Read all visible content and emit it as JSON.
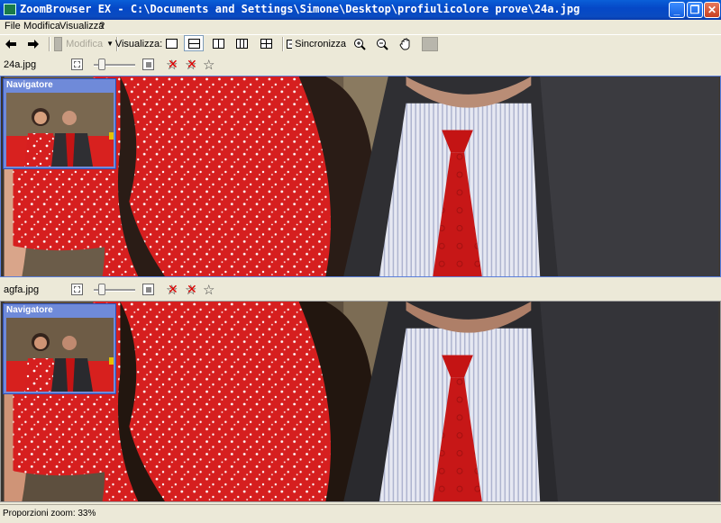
{
  "window": {
    "title": "ZoomBrowser EX - C:\\Documents and Settings\\Simone\\Desktop\\profiulicolore prove\\24a.jpg"
  },
  "menu": [
    "File",
    "Modifica",
    "Visualizza",
    "?"
  ],
  "toolbar": {
    "modifica_label": "Modifica",
    "visualizza_label": "Visualizza:",
    "sincronizza_label": "Sincronizza",
    "active_view": "split-horizontal"
  },
  "panels": [
    {
      "filename": "24a.jpg",
      "navigator_title": "Navigatore",
      "zoom_slider_value": 0.2
    },
    {
      "filename": "agfa.jpg",
      "navigator_title": "Navigatore",
      "zoom_slider_value": 0.2
    }
  ],
  "status": {
    "zoom_text": "Proporzioni zoom: 33%"
  },
  "colors": {
    "titlebar": "#0a4bc0",
    "navigator": "#6f8ad9",
    "shirt_red": "#d42020",
    "tie_red": "#c81818",
    "jacket": "#3a3a3e"
  }
}
